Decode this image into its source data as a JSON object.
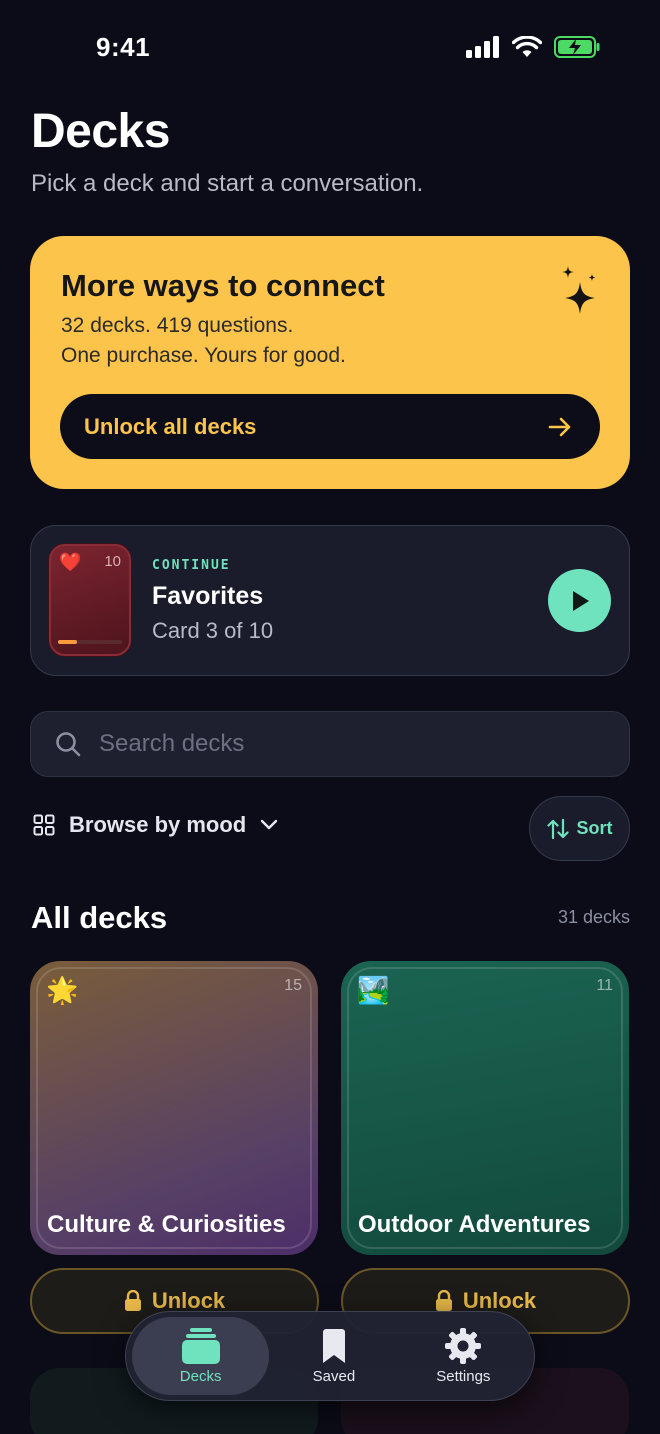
{
  "status": {
    "time": "9:41"
  },
  "header": {
    "title": "Decks",
    "subtitle": "Pick a deck and start a conversation."
  },
  "promo": {
    "title": "More ways to connect",
    "line1": "32 decks. 419 questions.",
    "line2": "One purchase. Yours for good.",
    "button_label": "Unlock all decks",
    "icon": "sparkle-icon"
  },
  "continue_card": {
    "kicker": "CONTINUE",
    "title": "Favorites",
    "progress_text": "Card 3 of 10",
    "thumb_emoji": "❤️",
    "thumb_count": "10",
    "progress_fraction": 0.3
  },
  "search": {
    "placeholder": "Search decks"
  },
  "filters": {
    "mood_label": "Browse by mood",
    "sort_label": "Sort"
  },
  "section": {
    "title": "All decks",
    "count": "31 decks"
  },
  "decks": [
    {
      "emoji": "🌟",
      "count": "15",
      "title": "Culture & Curiosities",
      "unlock_label": "Unlock"
    },
    {
      "emoji": "🏞️",
      "count": "11",
      "title": "Outdoor Adventures",
      "unlock_label": "Unlock"
    }
  ],
  "tabbar": {
    "tabs": [
      {
        "label": "Decks",
        "icon": "cards-icon",
        "active": true
      },
      {
        "label": "Saved",
        "icon": "bookmark-icon",
        "active": false
      },
      {
        "label": "Settings",
        "icon": "gear-icon",
        "active": false
      }
    ]
  },
  "colors": {
    "background": "#0c0c18",
    "promo": "#fdc44b",
    "accent": "#6ee3bd",
    "unlock": "#e7b84a"
  }
}
